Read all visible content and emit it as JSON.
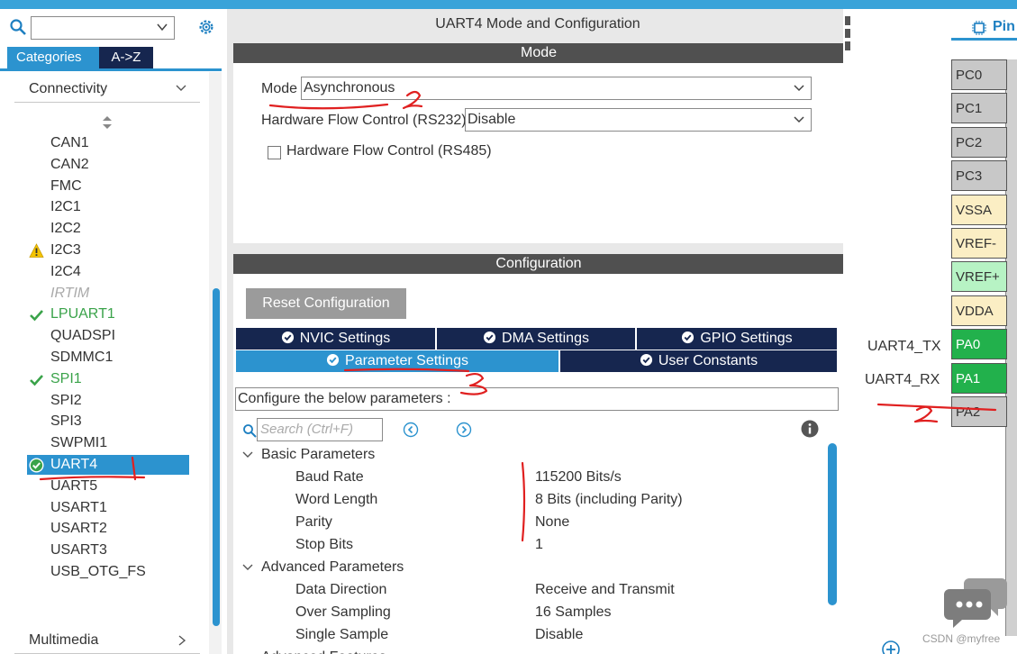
{
  "left_panel": {
    "tabs": [
      "Categories",
      "A->Z"
    ],
    "category_header": "Connectivity",
    "items": [
      {
        "label": "CAN1",
        "status": "none"
      },
      {
        "label": "CAN2",
        "status": "none"
      },
      {
        "label": "FMC",
        "status": "none"
      },
      {
        "label": "I2C1",
        "status": "none"
      },
      {
        "label": "I2C2",
        "status": "none"
      },
      {
        "label": "I2C3",
        "status": "warning"
      },
      {
        "label": "I2C4",
        "status": "none"
      },
      {
        "label": "IRTIM",
        "status": "disabled"
      },
      {
        "label": "LPUART1",
        "status": "ok"
      },
      {
        "label": "QUADSPI",
        "status": "none"
      },
      {
        "label": "SDMMC1",
        "status": "none"
      },
      {
        "label": "SPI1",
        "status": "ok"
      },
      {
        "label": "SPI2",
        "status": "none"
      },
      {
        "label": "SPI3",
        "status": "none"
      },
      {
        "label": "SWPMI1",
        "status": "none"
      },
      {
        "label": "UART4",
        "status": "selected"
      },
      {
        "label": "UART5",
        "status": "none"
      },
      {
        "label": "USART1",
        "status": "none"
      },
      {
        "label": "USART2",
        "status": "none"
      },
      {
        "label": "USART3",
        "status": "none"
      },
      {
        "label": "USB_OTG_FS",
        "status": "none"
      }
    ],
    "footer_category": "Multimedia"
  },
  "center_panel": {
    "title": "UART4 Mode and Configuration",
    "mode_bar": "Mode",
    "mode_label": "Mode",
    "mode_value": "Asynchronous",
    "hw_flow_rs232_label": "Hardware Flow Control (RS232)",
    "hw_flow_rs232_value": "Disable",
    "hw_flow_rs485_label": "Hardware Flow Control (RS485)",
    "config_bar": "Configuration",
    "reset_button": "Reset Configuration",
    "tabs_row1": [
      "NVIC Settings",
      "DMA Settings",
      "GPIO Settings"
    ],
    "tabs_row2": [
      "Parameter Settings",
      "User Constants"
    ],
    "configure_text": "Configure the below parameters :",
    "search_placeholder": "Search (Ctrl+F)",
    "groups": [
      {
        "name": "Basic Parameters",
        "params": [
          {
            "name": "Baud Rate",
            "value": "115200 Bits/s"
          },
          {
            "name": "Word Length",
            "value": "8 Bits (including Parity)"
          },
          {
            "name": "Parity",
            "value": "None"
          },
          {
            "name": "Stop Bits",
            "value": "1"
          }
        ]
      },
      {
        "name": "Advanced Parameters",
        "params": [
          {
            "name": "Data Direction",
            "value": "Receive and Transmit"
          },
          {
            "name": "Over Sampling",
            "value": "16 Samples"
          },
          {
            "name": "Single Sample",
            "value": "Disable"
          }
        ]
      },
      {
        "name": "Advanced Features",
        "params": []
      }
    ]
  },
  "right_panel": {
    "tab_label": "Pin",
    "pins": [
      {
        "label": "PC0",
        "kind": "gray"
      },
      {
        "label": "PC1",
        "kind": "gray"
      },
      {
        "label": "PC2",
        "kind": "gray"
      },
      {
        "label": "PC3",
        "kind": "gray"
      },
      {
        "label": "VSSA",
        "kind": "power"
      },
      {
        "label": "VREF-",
        "kind": "power"
      },
      {
        "label": "VREF+",
        "kind": "vrefp"
      },
      {
        "label": "VDDA",
        "kind": "power"
      },
      {
        "label": "PA0",
        "kind": "green"
      },
      {
        "label": "PA1",
        "kind": "green"
      },
      {
        "label": "PA2",
        "kind": "gray"
      }
    ],
    "signal_tx": "UART4_TX",
    "signal_rx": "UART4_RX",
    "watermark": "CSDN @myfree"
  },
  "colors": {
    "accent": "#2c93cf",
    "dark_tab": "#16264f",
    "bar": "#505050",
    "ok_green": "#3aa34a",
    "pin_green": "#22b14c",
    "annotation_red": "#e02020"
  }
}
